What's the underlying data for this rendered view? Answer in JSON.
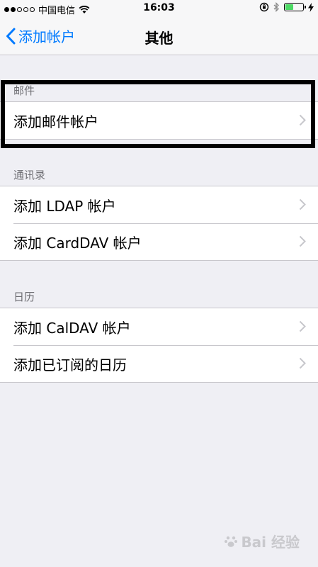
{
  "status_bar": {
    "carrier": "中国电信",
    "time": "16:03",
    "signal_dots_filled": 2,
    "signal_dots_total": 5,
    "battery_level": 0.45
  },
  "nav": {
    "back_label": "添加帐户",
    "title": "其他"
  },
  "sections": [
    {
      "header": "邮件",
      "items": [
        "添加邮件帐户"
      ]
    },
    {
      "header": "通讯录",
      "items": [
        "添加 LDAP 帐户",
        "添加 CardDAV 帐户"
      ]
    },
    {
      "header": "日历",
      "items": [
        "添加 CalDAV 帐户",
        "添加已订阅的日历"
      ]
    }
  ],
  "watermark": {
    "text": "Bai 经验"
  },
  "colors": {
    "accent": "#007aff",
    "background": "#efeff4",
    "battery_green": "#4cd964"
  }
}
